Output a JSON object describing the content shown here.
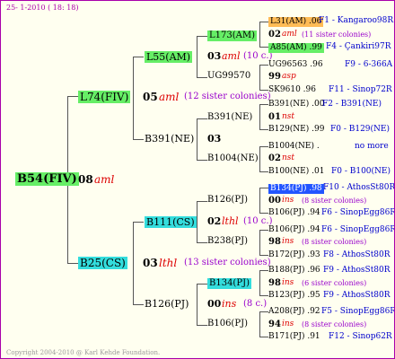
{
  "header": "25-  1-2010 ( 18: 18)",
  "footer": "Copyright 2004-2010 @ Karl Kehde Foundation.",
  "root": {
    "name": "B54(FIV)"
  },
  "g1": {
    "num": "08",
    "code": "aml"
  },
  "p": {
    "name": "L74(FIV)",
    "num": "05",
    "code": "aml",
    "sis": "(12 sister colonies)"
  },
  "m": {
    "name": "B25(CS)",
    "num": "03",
    "code": "lthl",
    "sis": "(13 sister colonies)"
  },
  "pp": {
    "name": "L55(AM)",
    "num": "03",
    "code": "aml",
    "sis": "(10 c.)"
  },
  "pm": {
    "name": "B391(NE)",
    "num": "03"
  },
  "mp": {
    "name": "B111(CS)",
    "num": "02",
    "code": "lthl",
    "sis": "(10 c.)"
  },
  "mm": {
    "name": "B126(PJ)",
    "num": "00",
    "code": "ins",
    "sis": "(8 c.)"
  },
  "g4": [
    {
      "name": "L173(AM)",
      "num": "02",
      "code": "aml",
      "sis": "(11 sister colonies)",
      "l1": "L31(AM) .06",
      "i1": "F1 - Kangaroo98R",
      "l2": "A85(AM) .99",
      "i2": "F4 - Çankiri97R"
    },
    {
      "name": "UG99570",
      "num": "99",
      "code": "asp",
      "l1": "UG96563 .96",
      "i1": "F9 - 6-366A",
      "l2": "SK9610 .96",
      "i2": "F11 - Sinop72R"
    },
    {
      "name": "B391(NE)",
      "num": "01",
      "code": "nst",
      "l1": "B391(NE) .00",
      "i1": "F2 - B391(NE)",
      "l2": "B129(NE) .99",
      "i2": "F0 - B129(NE)"
    },
    {
      "name": "B1004(NE)",
      "num": "02",
      "code": "nst",
      "l1": "B1004(NE) .",
      "i1": "no more",
      "l2": "B100(NE) .01",
      "i2": "F0 - B100(NE)"
    },
    {
      "name": "B126(PJ)",
      "num": "00",
      "code": "ins",
      "sis": "(8 sister colonies)",
      "l1": "B134(PJ) .98",
      "i1": "F10 - AthosSt80R",
      "l2": "B106(PJ) .94",
      "i2": "F6 - SinopEgg86R"
    },
    {
      "name": "B238(PJ)",
      "num": "98",
      "code": "ins",
      "sis": "(8 sister colonies)",
      "l1": "B106(PJ) .94",
      "i1": "F6 - SinopEgg86R",
      "l2": "B172(PJ) .93",
      "i2": "F8 - AthosSt80R"
    },
    {
      "name": "B134(PJ)",
      "num": "98",
      "code": "ins",
      "sis": "(6 sister colonies)",
      "l1": "B188(PJ) .96",
      "i1": "F9 - AthosSt80R",
      "l2": "B123(PJ) .95",
      "i2": "F9 - AthosSt80R"
    },
    {
      "name": "B106(PJ)",
      "num": "94",
      "code": "ins",
      "sis": "(8 sister colonies)",
      "l1": "A208(PJ) .92",
      "i1": "F5 - SinopEgg86R",
      "l2": "B171(PJ) .91",
      "i2": "F12 - Sinop62R"
    }
  ]
}
